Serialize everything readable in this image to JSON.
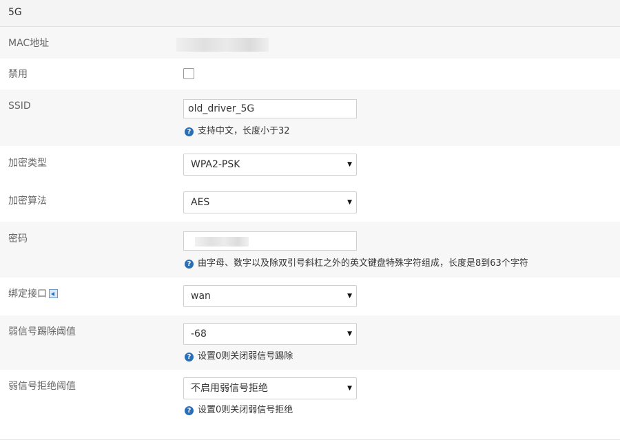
{
  "header": {
    "title": "5G"
  },
  "mac": {
    "label": "MAC地址"
  },
  "disable": {
    "label": "禁用",
    "checked": false
  },
  "ssid": {
    "label": "SSID",
    "value": "old_driver_5G",
    "hint": "支持中文，长度小于32"
  },
  "encryption": {
    "label": "加密类型",
    "value": "WPA2-PSK"
  },
  "algorithm": {
    "label": "加密算法",
    "value": "AES"
  },
  "password": {
    "label": "密码",
    "hint": "由字母、数字以及除双引号斜杠之外的英文键盘特殊字符组成，长度是8到63个字符"
  },
  "bind": {
    "label": "绑定接口",
    "value": "wan"
  },
  "kick": {
    "label": "弱信号踢除阈值",
    "value": "-68",
    "hint": "设置0则关闭弱信号踢除"
  },
  "reject": {
    "label": "弱信号拒绝阈值",
    "value": "不启用弱信号拒绝",
    "hint": "设置0则关闭弱信号拒绝"
  },
  "icons": {
    "help": "question-circle-icon",
    "dropdown": "triangle-down-icon",
    "bind": "back-arrow-icon"
  },
  "colors": {
    "accent": "#2a6eb8",
    "row_alt": "#f7f7f7",
    "header_bg": "#f4f4f4"
  }
}
